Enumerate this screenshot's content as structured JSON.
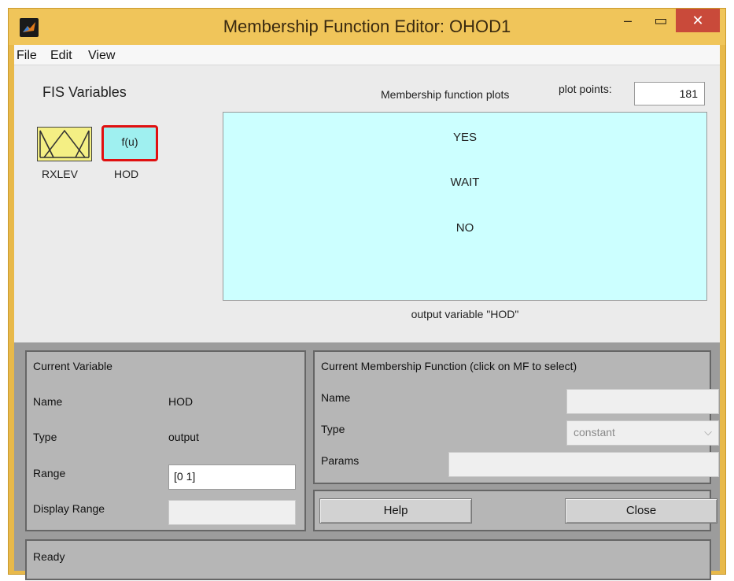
{
  "window": {
    "title": "Membership Function Editor: OHOD1",
    "minimize_glyph": "–",
    "maximize_glyph": "▭",
    "close_glyph": "✕"
  },
  "menu": {
    "file": "File",
    "edit": "Edit",
    "view": "View"
  },
  "fis": {
    "heading": "FIS Variables",
    "variables": [
      {
        "name": "RXLEV",
        "kind": "input",
        "color": "#f4ef84"
      },
      {
        "name": "HOD",
        "kind": "output",
        "symbol": "f(u)",
        "color": "#9ff0f0",
        "selected": true
      }
    ]
  },
  "plots": {
    "label": "Membership function plots",
    "plot_points_label": "plot points:",
    "plot_points_value": "181",
    "mf_names": [
      "YES",
      "WAIT",
      "NO"
    ],
    "caption": "output variable \"HOD\"",
    "background": "#ccffff"
  },
  "current_variable": {
    "title": "Current Variable",
    "name_label": "Name",
    "name_value": "HOD",
    "type_label": "Type",
    "type_value": "output",
    "range_label": "Range",
    "range_value": "[0 1]",
    "display_range_label": "Display Range",
    "display_range_value": ""
  },
  "current_mf": {
    "title": "Current Membership Function (click on MF to select)",
    "name_label": "Name",
    "name_value": "",
    "type_label": "Type",
    "type_value": "constant",
    "params_label": "Params",
    "params_value": ""
  },
  "buttons": {
    "help": "Help",
    "close": "Close"
  },
  "status": {
    "text": "Ready"
  },
  "colors": {
    "title_bar": "#f0c55a",
    "close_button": "#c94a3a",
    "selection_border": "#e01010"
  }
}
